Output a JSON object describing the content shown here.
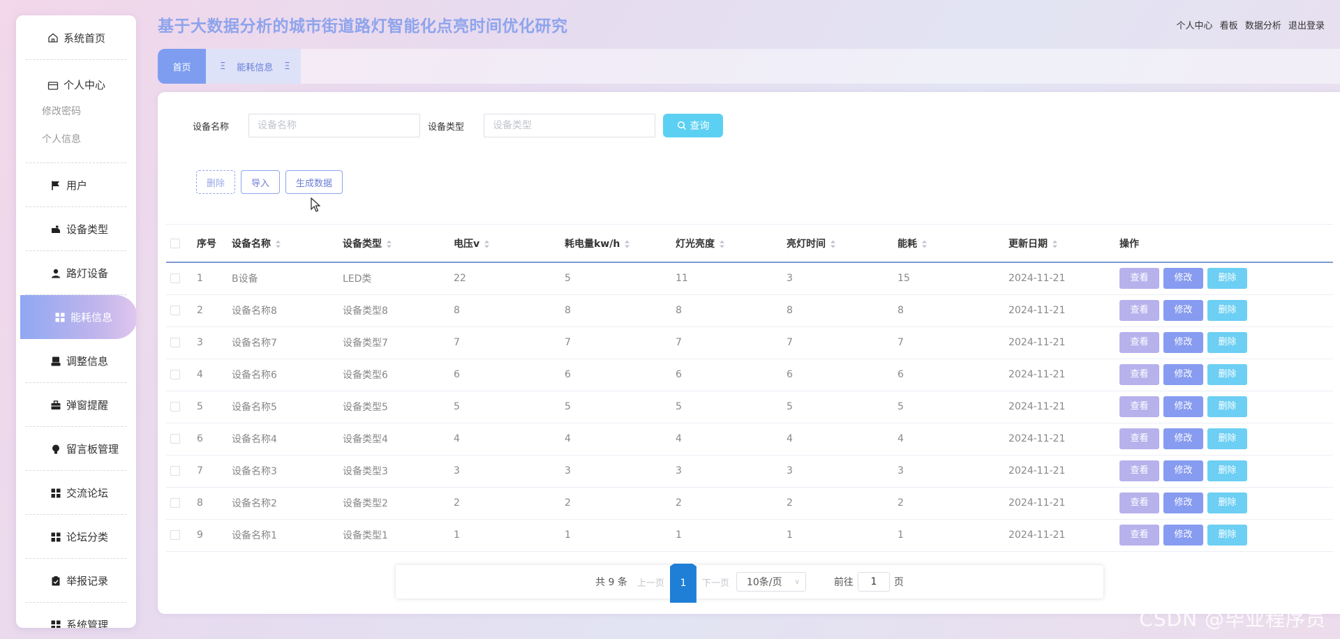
{
  "header": {
    "title": "基于大数据分析的城市街道路灯智能化点亮时间优化研究",
    "links": [
      "个人中心",
      "看板",
      "数据分析",
      "退出登录"
    ]
  },
  "sidebar": {
    "home": "系统首页",
    "personal": "个人中心",
    "personal_sub": [
      "修改密码",
      "个人信息"
    ],
    "items": [
      {
        "label": "用户",
        "icon": "flag-icon"
      },
      {
        "label": "设备类型",
        "icon": "tag-icon"
      },
      {
        "label": "路灯设备",
        "icon": "user-icon"
      },
      {
        "label": "能耗信息",
        "icon": "grid-icon"
      },
      {
        "label": "调整信息",
        "icon": "printer-icon"
      },
      {
        "label": "弹窗提醒",
        "icon": "briefcase-icon"
      },
      {
        "label": "留言板管理",
        "icon": "bulb-icon"
      },
      {
        "label": "交流论坛",
        "icon": "grid-icon"
      },
      {
        "label": "论坛分类",
        "icon": "grid-icon"
      },
      {
        "label": "举报记录",
        "icon": "clipboard-icon"
      },
      {
        "label": "系统管理",
        "icon": "grid-icon"
      }
    ],
    "active": "能耗信息"
  },
  "tabs": {
    "home": "首页",
    "energy": "能耗信息"
  },
  "search": {
    "name_label": "设备名称",
    "name_placeholder": "设备名称",
    "type_label": "设备类型",
    "type_placeholder": "设备类型",
    "query_label": "查询"
  },
  "actions": {
    "delete": "删除",
    "import": "导入",
    "generate": "生成数据"
  },
  "table": {
    "headers": [
      "序号",
      "设备名称",
      "设备类型",
      "电压v",
      "耗电量kw/h",
      "灯光亮度",
      "亮灯时间",
      "能耗",
      "更新日期",
      "操作"
    ],
    "rows": [
      [
        "1",
        "B设备",
        "LED类",
        "22",
        "5",
        "11",
        "3",
        "15",
        "2024-11-21"
      ],
      [
        "2",
        "设备名称8",
        "设备类型8",
        "8",
        "8",
        "8",
        "8",
        "8",
        "2024-11-21"
      ],
      [
        "3",
        "设备名称7",
        "设备类型7",
        "7",
        "7",
        "7",
        "7",
        "7",
        "2024-11-21"
      ],
      [
        "4",
        "设备名称6",
        "设备类型6",
        "6",
        "6",
        "6",
        "6",
        "6",
        "2024-11-21"
      ],
      [
        "5",
        "设备名称5",
        "设备类型5",
        "5",
        "5",
        "5",
        "5",
        "5",
        "2024-11-21"
      ],
      [
        "6",
        "设备名称4",
        "设备类型4",
        "4",
        "4",
        "4",
        "4",
        "4",
        "2024-11-21"
      ],
      [
        "7",
        "设备名称3",
        "设备类型3",
        "3",
        "3",
        "3",
        "3",
        "3",
        "2024-11-21"
      ],
      [
        "8",
        "设备名称2",
        "设备类型2",
        "2",
        "2",
        "2",
        "2",
        "2",
        "2024-11-21"
      ],
      [
        "9",
        "设备名称1",
        "设备类型1",
        "1",
        "1",
        "1",
        "1",
        "1",
        "2024-11-21"
      ]
    ],
    "row_actions": {
      "view": "查看",
      "edit": "修改",
      "delete": "删除"
    }
  },
  "pagination": {
    "total": "共 9 条",
    "prev": "上一页",
    "current": "1",
    "next": "下一页",
    "page_size": "10条/页",
    "goto_prefix": "前往",
    "goto_value": "1",
    "goto_suffix": "页"
  },
  "watermark": "CSDN @毕业程序员",
  "colors": {
    "title": "#8ea4ec",
    "active_menu_start": "#8fa8f2",
    "query_button": "#5cd0f2",
    "view_button": "#b7b1ec",
    "edit_button": "#879bf0",
    "delete_button": "#6ccff3",
    "current_page": "#1f7fd6"
  }
}
